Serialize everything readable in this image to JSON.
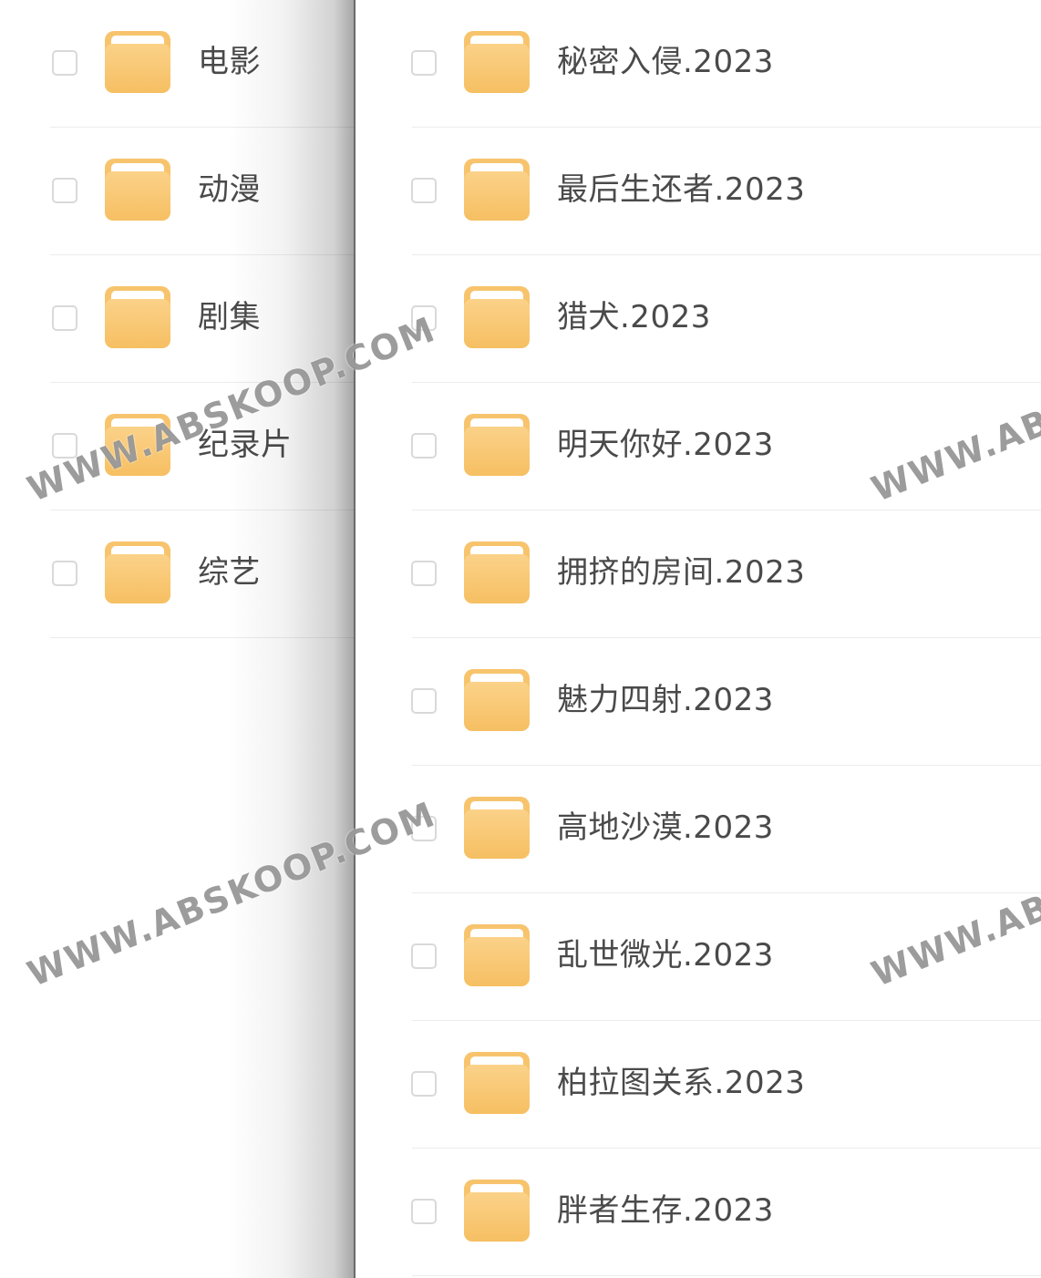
{
  "left_list": {
    "items": [
      {
        "label": "电影"
      },
      {
        "label": "动漫"
      },
      {
        "label": "剧集"
      },
      {
        "label": "纪录片"
      },
      {
        "label": "综艺"
      }
    ]
  },
  "right_list": {
    "items": [
      {
        "label": "秘密入侵.2023"
      },
      {
        "label": "最后生还者.2023"
      },
      {
        "label": "猎犬.2023"
      },
      {
        "label": "明天你好.2023"
      },
      {
        "label": "拥挤的房间.2023"
      },
      {
        "label": "魅力四射.2023"
      },
      {
        "label": "高地沙漠.2023"
      },
      {
        "label": "乱世微光.2023"
      },
      {
        "label": "柏拉图关系.2023"
      },
      {
        "label": "胖者生存.2023"
      }
    ]
  },
  "watermark": {
    "text": "WWW.ABSKOOP.COM"
  },
  "colors": {
    "folder": "#f7c46d",
    "text": "#4a4a4a",
    "checkbox_border": "#d9d9d9",
    "separator": "#ececec"
  }
}
